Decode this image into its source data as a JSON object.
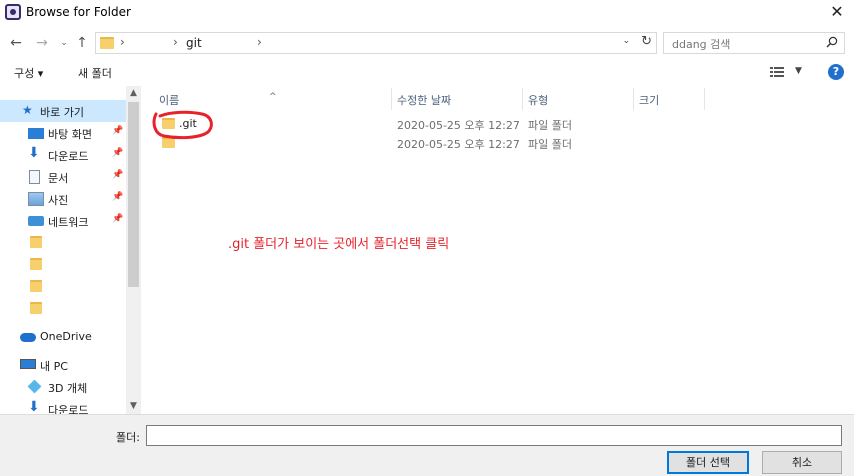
{
  "window": {
    "title": "Browse for Folder"
  },
  "address": {
    "segment": "git",
    "sep": "›"
  },
  "search": {
    "placeholder": "ddang 검색"
  },
  "toolbar": {
    "organize": "구성 ▾",
    "new_folder": "새 폴더"
  },
  "navpane": {
    "items": [
      {
        "label": "바로 가기",
        "icon": "star-icon",
        "pinned": false,
        "selected": true
      },
      {
        "label": "바탕 화면",
        "icon": "desktop-icon",
        "pinned": true
      },
      {
        "label": "다운로드",
        "icon": "download-icon",
        "pinned": true
      },
      {
        "label": "문서",
        "icon": "document-icon",
        "pinned": true
      },
      {
        "label": "사진",
        "icon": "pictures-icon",
        "pinned": true
      },
      {
        "label": "네트워크",
        "icon": "network-icon",
        "pinned": true
      },
      {
        "label": "",
        "icon": "folder-icon"
      },
      {
        "label": "",
        "icon": "folder-icon"
      },
      {
        "label": "",
        "icon": "folder-icon"
      },
      {
        "label": "",
        "icon": "folder-icon"
      },
      {
        "label": "OneDrive",
        "icon": "onedrive-icon"
      },
      {
        "label": "내 PC",
        "icon": "pc-icon"
      },
      {
        "label": "3D 개체",
        "icon": "3d-objects-icon"
      },
      {
        "label": "다운로드",
        "icon": "download-icon"
      }
    ]
  },
  "columns": {
    "name": "이름",
    "modified": "수정한 날짜",
    "type": "유형",
    "size": "크기"
  },
  "files": [
    {
      "name": ".git",
      "modified": "2020-05-25 오후 12:27",
      "type": "파일 폴더"
    },
    {
      "name": "",
      "modified": "2020-05-25 오후 12:27",
      "type": "파일 폴더"
    }
  ],
  "annotation": ".git 폴더가 보이는 곳에서 폴더선택 클릭",
  "footer": {
    "folder_label": "폴더:",
    "folder_value": "",
    "ok": "폴더 선택",
    "cancel": "취소"
  },
  "colors": {
    "accent": "#0078d7",
    "annotation": "#e8222a",
    "selected": "#cce8ff"
  }
}
